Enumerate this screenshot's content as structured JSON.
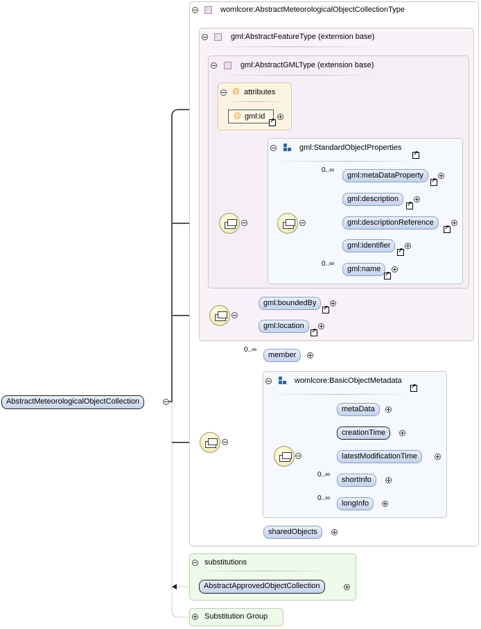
{
  "root": {
    "label": "AbstractMeteorologicalObjectCollection"
  },
  "complex_type": {
    "title": "womlcore:AbstractMeteorologicalObjectCollectionType",
    "feature_type": {
      "title": "gml:AbstractFeatureType (extension base)",
      "gml_type": {
        "title": "gml:AbstractGMLType (extension base)",
        "attributes": {
          "title": "attributes",
          "id_label": "gml:id"
        },
        "standard_props": {
          "title": "gml:StandardObjectProperties",
          "items": [
            {
              "label": "gml:metaDataProperty",
              "occurs": "0..∞"
            },
            {
              "label": "gml:description",
              "occurs": ""
            },
            {
              "label": "gml:descriptionReference",
              "occurs": ""
            },
            {
              "label": "gml:identifier",
              "occurs": ""
            },
            {
              "label": "gml:name",
              "occurs": "0..∞"
            }
          ]
        }
      },
      "bounded_by": "gml:boundedBy",
      "location": "gml:location"
    },
    "member": {
      "label": "member",
      "occurs": "0..∞"
    },
    "basic_metadata": {
      "title": "womlcore:BasicObjectMetadata",
      "items": [
        {
          "label": "metaData",
          "occurs": ""
        },
        {
          "label": "creationTime",
          "occurs": ""
        },
        {
          "label": "latestModificationTime",
          "occurs": ""
        },
        {
          "label": "shortInfo",
          "occurs": "0..∞"
        },
        {
          "label": "longInfo",
          "occurs": "0..∞"
        }
      ]
    },
    "shared_objects": "sharedObjects"
  },
  "substitutions": {
    "title": "substitutions",
    "item": "AbstractApprovedObjectCollection"
  },
  "substitution_group": {
    "title": "Substitution Group"
  }
}
